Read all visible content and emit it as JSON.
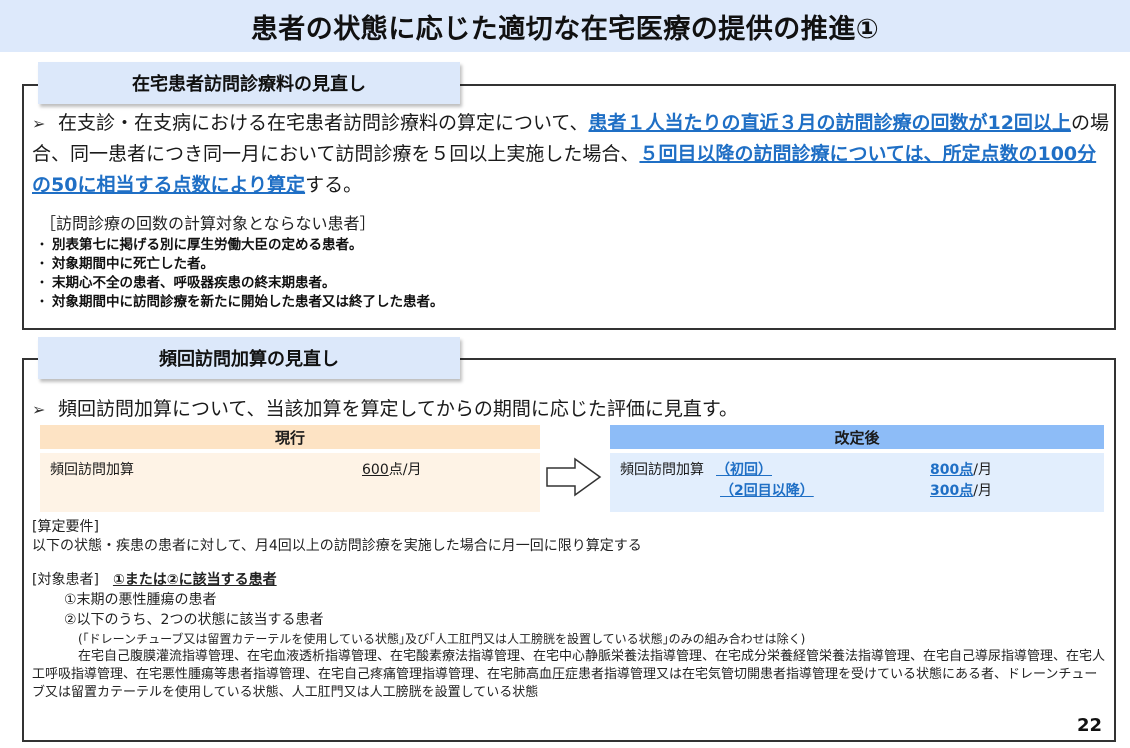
{
  "title": "患者の状態に応じた適切な在宅医療の提供の推進①",
  "section1": {
    "tab_label": "在宅患者訪問診療料の見直し",
    "bullet_glyph": "➢",
    "main_text": {
      "t1": "在支診・在支病における在宅患者訪問診療料の算定について、",
      "b1": "患者１人当たりの直近３月の訪問診療の回数が12回以上",
      "t2": "の場合、同一患者につき同一月において訪問診療を５回以上実施した場合、",
      "b2": "５回目以降の訪問診療については、所定点数の100分の50に相当する点数により算定",
      "t3": "する。"
    },
    "exclusion_title": "［訪問診療の回数の計算対象とならない患者］",
    "exclusions": [
      "別表第七に掲げる別に厚生労働大臣の定める患者。",
      "対象期間中に死亡した者。",
      "末期心不全の患者、呼吸器疾患の終末期患者。",
      "対象期間中に訪問診療を新たに開始した患者又は終了した患者。"
    ],
    "list_dot": "・"
  },
  "section2": {
    "tab_label": "頻回訪問加算の見直し",
    "bullet_glyph": "➢",
    "main_text": "頻回訪問加算について、当該加算を算定してからの期間に応じた評価に見直す。",
    "current": {
      "header": "現行",
      "name": "頻回訪問加算",
      "value_num": "600",
      "value_unit": "点/月"
    },
    "revised": {
      "header": "改定後",
      "name": "頻回訪問加算",
      "label1": "（初回）",
      "label2": "（2回目以降）",
      "value1_num": "800点",
      "value2_num": "300点",
      "unit": "/月"
    },
    "requirement_title": "[算定要件]",
    "requirement_text": "以下の状態・疾患の患者に対して、月4回以上の訪問診療を実施した場合に月一回に限り算定する",
    "target_title": "[対象患者]",
    "target_highlight": "①または②に該当する患者",
    "target_item1": "①末期の悪性腫瘍の患者",
    "target_item2": "②以下のうち、2つの状態に該当する患者",
    "target_note": "(｢ドレーンチューブ又は留置カテーテルを使用している状態｣及び｢人工肛門又は人工膀胱を設置している状態｣のみの組み合わせは除く)",
    "target_para": "在宅自己腹膜灌流指導管理、在宅血液透析指導管理、在宅酸素療法指導管理、在宅中心静脈栄養法指導管理、在宅成分栄養経管栄養法指導管理、在宅自己導尿指導管理、在宅人工呼吸指導管理、在宅悪性腫瘍等患者指導管理、在宅自己疼痛管理指導管理、在宅肺高血圧症患者指導管理又は在宅気管切開患者指導管理を受けている状態にある者、ドレーンチューブ又は留置カテーテルを使用している状態、人工肛門又は人工膀胱を設置している状態"
  },
  "page_number": "22",
  "colors": {
    "title_bg": "#dde9fb",
    "tab_bg": "#dce8fa",
    "highlight_blue": "#1f6fc5",
    "current_header": "#fde3c4",
    "current_body": "#fef3e6",
    "revised_header": "#8dbcf7",
    "revised_body": "#e2eefd"
  }
}
